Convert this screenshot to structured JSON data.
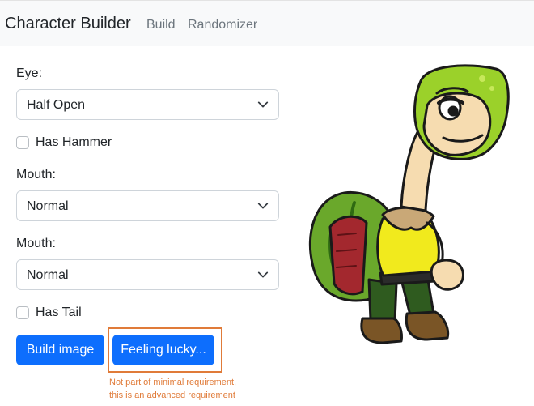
{
  "navbar": {
    "brand": "Character Builder",
    "links": [
      "Build",
      "Randomizer"
    ]
  },
  "form": {
    "eye": {
      "label": "Eye:",
      "value": "Half Open"
    },
    "has_hammer": {
      "label": "Has Hammer",
      "checked": false
    },
    "mouth1": {
      "label": "Mouth:",
      "value": "Normal"
    },
    "mouth2": {
      "label": "Mouth:",
      "value": "Normal"
    },
    "has_tail": {
      "label": "Has Tail",
      "checked": false
    }
  },
  "buttons": {
    "build": "Build image",
    "lucky": "Feeling lucky..."
  },
  "annotation": {
    "line1": "Not part of minimal requirement,",
    "line2": "this is an advanced requirement"
  },
  "colors": {
    "primary": "#0d6efd",
    "annotation": "#e07b39"
  },
  "icons": [
    "chevron-down-icon"
  ]
}
